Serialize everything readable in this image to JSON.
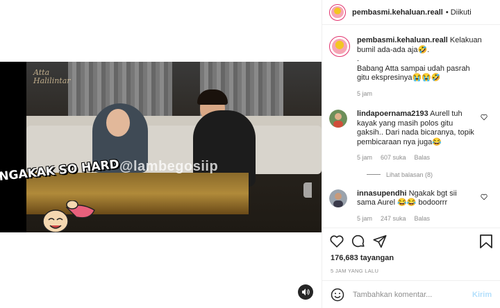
{
  "post": {
    "username": "pembasmi.kehaluan.reall",
    "follow_separator": "•",
    "follow_status": "Diikuti"
  },
  "video": {
    "watermark": "@lambegosiip",
    "overlay_caption": "NGAKAK SO HARD",
    "scene_logo": "Atta\nHalilintar"
  },
  "caption": {
    "username": "pembasmi.kehaluan.reall",
    "line1": "Kelakuan bumil ada-ada aja🤣.",
    "line2": ".",
    "line3": "Babang Atta sampai udah pasrah gitu ekspresinya😭😭🤣",
    "time": "5 jam"
  },
  "comments": [
    {
      "username": "lindapoernama2193",
      "text": "Aurell tuh kayak yang masih polos gitu gaksih.. Dari nada bicaranya, topik pembicaraan nya juga😂",
      "time": "5 jam",
      "likes": "607 suka",
      "reply": "Balas",
      "view_replies": "Lihat balasan (8)"
    },
    {
      "username": "innasupendhi",
      "text": "Ngakak bgt sii sama Aurel 😂😂 bodoorrr",
      "time": "5 jam",
      "likes": "247 suka",
      "reply": "Balas"
    }
  ],
  "stats": {
    "views": "176,683 tayangan",
    "time_ago": "5 JAM YANG LALU"
  },
  "composer": {
    "placeholder": "Tambahkan komentar...",
    "post_label": "Kirim"
  },
  "icons": {
    "heart": "heart-icon",
    "comment": "comment-icon",
    "share": "share-icon",
    "save": "bookmark-icon",
    "emoji": "emoji-icon",
    "volume": "volume-icon"
  },
  "colors": {
    "accent_link": "#b2dffc",
    "meta_gray": "#8e8e8e",
    "text": "#262626"
  }
}
